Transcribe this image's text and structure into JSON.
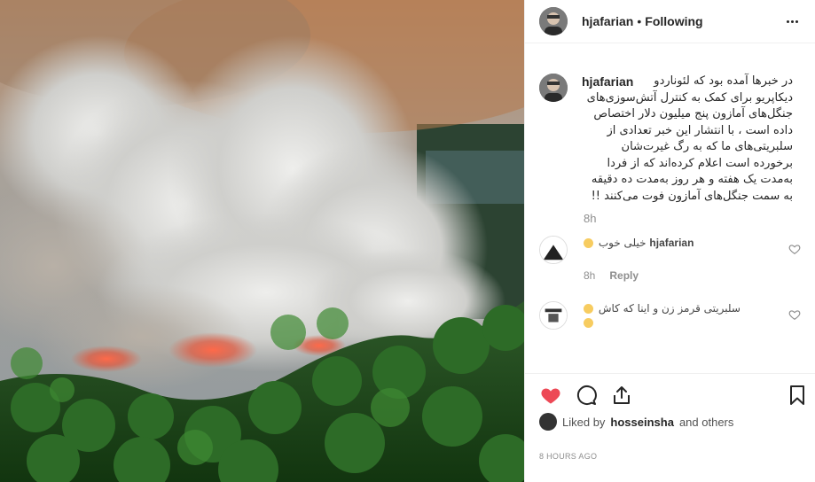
{
  "post": {
    "image_alt": "Aerial view of Amazon rainforest fire with smoke"
  },
  "header": {
    "username": "hjafarian",
    "separator": "•",
    "follow_status": "Following",
    "more_icon": "more-dots-icon"
  },
  "caption": {
    "username": "hjafarian",
    "text": "در خبرها آمده بود که لئوناردو دیکاپریو برای کمک به کنترل آتش‌سوزی‌های جنگل‌های آمازون پنج میلیون دلار اختصاص داده است ، با انتشار این خبر تعدادی از سلبریتی‌های ما که به رگ غیرت‌شان برخورده است اعلام کرده‌اند که از فردا به‌مدت یک هفته و هر روز به‌مدت ده دقیقه به سمت جنگل‌های آمازون فوت می‌کنند !!",
    "time": "8h"
  },
  "comments": [
    {
      "username": "hjafarian",
      "text": "خیلی خوب",
      "time": "8h",
      "reply_label": "Reply"
    },
    {
      "username": "",
      "text": "سلبریتی قرمز زن و اینا که کاش",
      "time": "",
      "reply_label": ""
    }
  ],
  "actions": {
    "like_icon": "heart-filled-icon",
    "comment_icon": "comment-icon",
    "share_icon": "share-icon",
    "save_icon": "bookmark-icon",
    "like_color": "#ed4956"
  },
  "likes": {
    "prefix": "Liked by",
    "username": "hosseinsha",
    "suffix": "and others"
  },
  "timestamp": "8 HOURS AGO"
}
